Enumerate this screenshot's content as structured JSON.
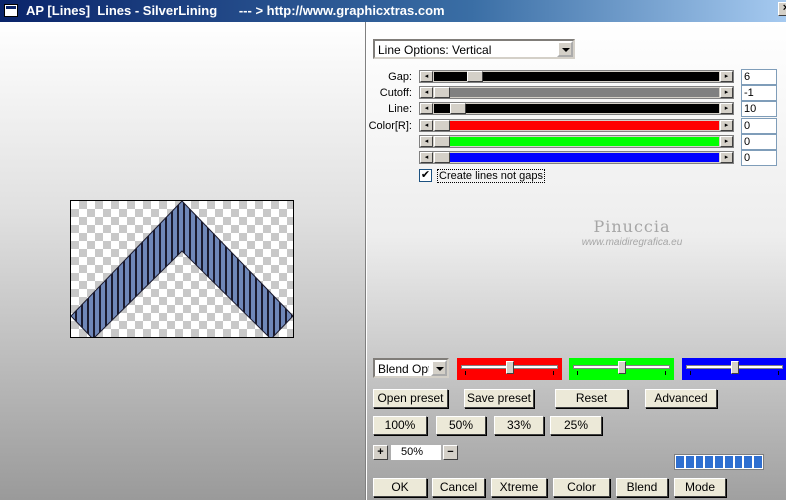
{
  "window": {
    "title": "AP [Lines]  Lines - SilverLining      --- > http://www.graphicxtras.com",
    "close_label": "×"
  },
  "line_options": {
    "selected": "Line Options: Vertical"
  },
  "sliders": [
    {
      "label": "Gap:",
      "value": "6",
      "track_color": "#000000",
      "thumb_pos": 0.12
    },
    {
      "label": "Cutoff:",
      "value": "-1",
      "track_color": "#808080",
      "thumb_pos": 0.0
    },
    {
      "label": "Line:",
      "value": "10",
      "track_color": "#000000",
      "thumb_pos": 0.06
    },
    {
      "label": "Color[R]:",
      "value": "0",
      "track_color": "#ff0000",
      "thumb_pos": 0.0
    },
    {
      "label": "",
      "value": "0",
      "track_color": "#00ff00",
      "thumb_pos": 0.0
    },
    {
      "label": "",
      "value": "0",
      "track_color": "#0000ff",
      "thumb_pos": 0.0
    }
  ],
  "create_lines": {
    "label": "Create lines not gaps",
    "checked": true,
    "check_glyph": "✔"
  },
  "watermark": {
    "name": "Pinuccia",
    "url": "www.maidiregrafica.eu"
  },
  "blend_options": {
    "selected": "Blend Options"
  },
  "color_sliders": [
    {
      "color": "#ff0000",
      "level": 0.5
    },
    {
      "color": "#00ff00",
      "level": 0.5
    },
    {
      "color": "#0000ff",
      "level": 0.5
    }
  ],
  "buttons_row1": [
    "Open preset",
    "Save preset",
    "Reset",
    "Advanced"
  ],
  "zoom_buttons": [
    "100%",
    "50%",
    "33%",
    "25%"
  ],
  "zoom": {
    "plus": "+",
    "value": "50%",
    "minus": "−"
  },
  "bottom_buttons": [
    "OK",
    "Cancel",
    "Xtreme",
    "Color",
    "Blend",
    "Mode"
  ],
  "progress": {
    "filled_segments": 9
  },
  "preview": {
    "shape_color": "#6f87b8",
    "line_color": "#1a1a2e"
  }
}
